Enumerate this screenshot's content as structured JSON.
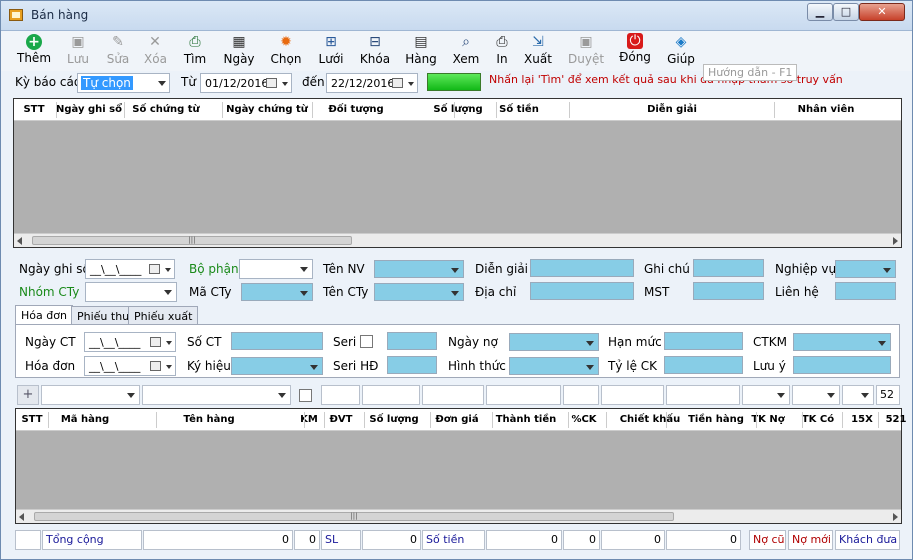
{
  "window": {
    "title": "Bán hàng"
  },
  "toolbar": [
    {
      "id": "them",
      "label": "Thêm",
      "icon": "add-icon",
      "glyph": "+",
      "color": "#1aa84a",
      "disabled": false
    },
    {
      "id": "luu",
      "label": "Lưu",
      "icon": "save-icon",
      "glyph": "▣",
      "color": "#9a9a9a",
      "disabled": true
    },
    {
      "id": "sua",
      "label": "Sửa",
      "icon": "edit-icon",
      "glyph": "✎",
      "color": "#9a9a9a",
      "disabled": true
    },
    {
      "id": "xoa",
      "label": "Xóa",
      "icon": "delete-icon",
      "glyph": "✕",
      "color": "#9a9a9a",
      "disabled": true
    },
    {
      "id": "tim",
      "label": "Tìm",
      "icon": "find-icon",
      "glyph": "⎙",
      "color": "#1a6a2a",
      "disabled": false
    },
    {
      "id": "ngay",
      "label": "Ngày",
      "icon": "calendar-icon",
      "glyph": "▦",
      "color": "#333333",
      "disabled": false
    },
    {
      "id": "chon",
      "label": "Chọn",
      "icon": "gear-icon",
      "glyph": "✹",
      "color": "#e86a10",
      "disabled": false
    },
    {
      "id": "luoi",
      "label": "Lưới",
      "icon": "grid-icon",
      "glyph": "⊞",
      "color": "#2a5a9a",
      "disabled": false
    },
    {
      "id": "khoa",
      "label": "Khóa",
      "icon": "lock-icon",
      "glyph": "⊟",
      "color": "#2a4a7a",
      "disabled": false
    },
    {
      "id": "hang",
      "label": "Hàng",
      "icon": "books-icon",
      "glyph": "▤",
      "color": "#333333",
      "disabled": false
    },
    {
      "id": "xem",
      "label": "Xem",
      "icon": "preview-icon",
      "glyph": "⌕",
      "color": "#2a4a7a",
      "disabled": false
    },
    {
      "id": "in",
      "label": "In",
      "icon": "printer-icon",
      "glyph": "⎙",
      "color": "#222222",
      "disabled": false
    },
    {
      "id": "xuat",
      "label": "Xuất",
      "icon": "export-icon",
      "glyph": "⇲",
      "color": "#2a6aaa",
      "disabled": false
    },
    {
      "id": "duyet",
      "label": "Duyệt",
      "icon": "approve-icon",
      "glyph": "▣",
      "color": "#9a9a9a",
      "disabled": true
    },
    {
      "id": "dong",
      "label": "Đóng",
      "icon": "power-icon",
      "glyph": "⏻",
      "color": "#d81a1a",
      "disabled": false
    },
    {
      "id": "giup",
      "label": "Giúp",
      "icon": "help-book-icon",
      "glyph": "◈",
      "color": "#1a7ac8",
      "disabled": false
    }
  ],
  "filter": {
    "period_label": "Kỳ báo cáo",
    "period_value": "Tự chọn",
    "from_label": "Từ",
    "from_date": "01/12/2016",
    "to_label": "đến",
    "to_date": "22/12/2016",
    "hint": "Nhấn lại 'Tìm' để xem kết quả sau khi đã nhập tham số truy vấn",
    "tooltip": "Hướng dẫn - F1"
  },
  "master_grid": {
    "columns": [
      "STT",
      "Ngày ghi sổ",
      "Số chứng từ",
      "Ngày chứng từ",
      "Đối tượng",
      "Số lượng",
      "Số tiền",
      "Diễn giải",
      "Nhân viên"
    ]
  },
  "header_form": {
    "ngay_ghi_so": "Ngày ghi sổ",
    "ngay_ghi_so_value": "__\\__\\____",
    "bo_phan": "Bộ phận",
    "ten_nv": "Tên NV",
    "dien_giai": "Diễn giải",
    "ghi_chu": "Ghi chú",
    "nghiep_vu": "Nghiệp vụ",
    "nhom_cty": "Nhóm CTy",
    "ma_cty": "Mã CTy",
    "ten_cty": "Tên CTy",
    "dia_chi": "Địa chỉ",
    "mst": "MST",
    "lien_he": "Liên hệ"
  },
  "tabs": [
    "Hóa đơn",
    "Phiếu thu",
    "Phiếu xuất"
  ],
  "invoice": {
    "ngay_ct": "Ngày CT",
    "ngay_ct_value": "__\\__\\____",
    "so_ct": "Số CT",
    "seri": "Seri",
    "ngay_no": "Ngày nợ",
    "han_muc": "Hạn mức",
    "ctkm": "CTKM",
    "hoa_don": "Hóa đơn",
    "hoa_don_value": "__\\__\\____",
    "ky_hieu": "Ký hiệu",
    "seri_hd": "Seri HĐ",
    "hinh_thuc": "Hình thức",
    "ty_le_ck": "Tỷ lệ CK",
    "luu_y": "Lưu ý"
  },
  "detail_bar": {
    "last_value": "52"
  },
  "detail_grid": {
    "columns": [
      "STT",
      "Mã hàng",
      "Tên hàng",
      "KM",
      "ĐVT",
      "Số lượng",
      "Đơn giá",
      "Thành tiền",
      "%CK",
      "Chiết khấu",
      "Tiền hàng",
      "TK Nợ",
      "TK Có",
      "15X",
      "521"
    ]
  },
  "totals": {
    "label": "Tổng cộng",
    "v1": "0",
    "v2": "0",
    "sl_label": "SL",
    "sl_value": "0",
    "so_tien_label": "Số tiền",
    "v3": "0",
    "v4": "0",
    "v5": "0",
    "v6": "0",
    "no_cu": "Nợ cũ",
    "no_moi": "Nợ mới",
    "khach_dua": "Khách đưa"
  }
}
